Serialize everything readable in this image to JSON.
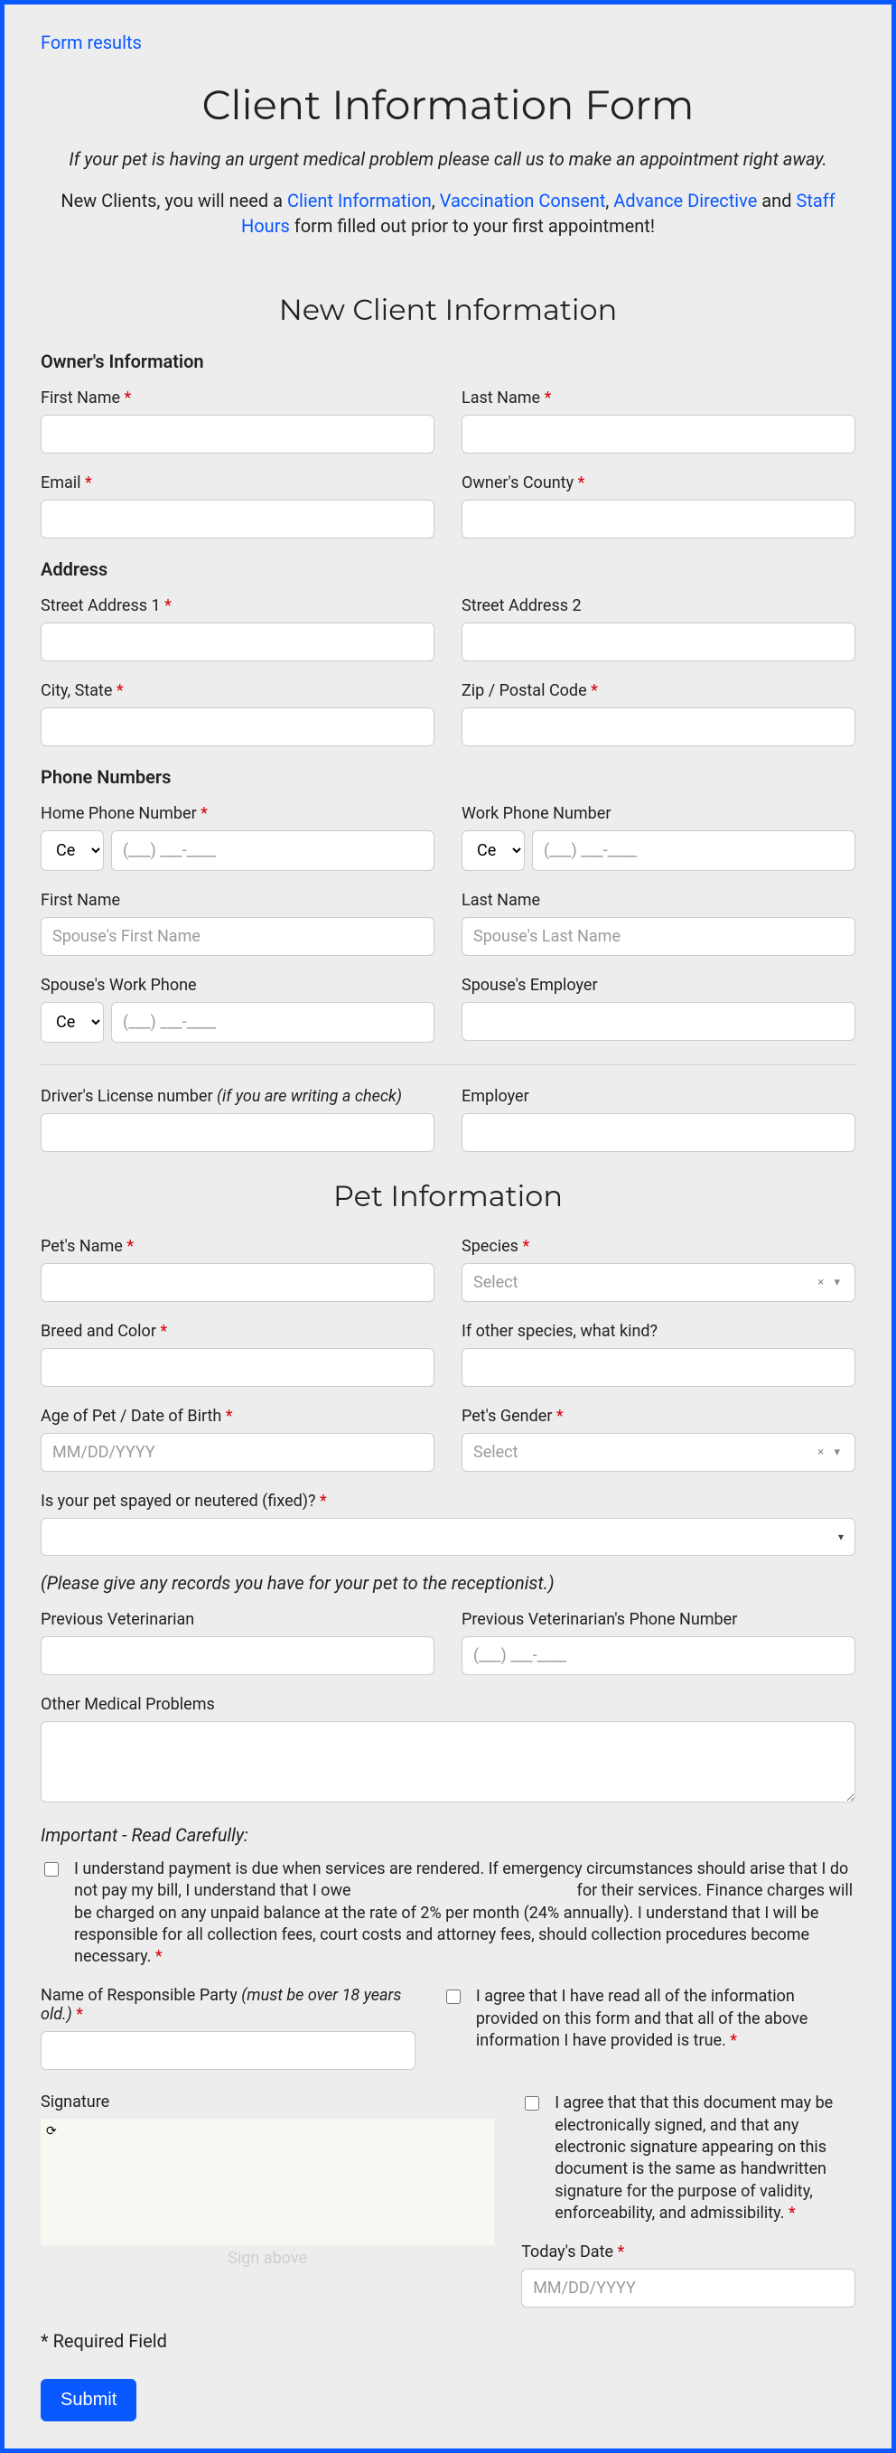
{
  "topLink": "Form results",
  "title": "Client Information Form",
  "subtitle": "If your pet is having an urgent medical problem please call us to make an appointment right away.",
  "introStart": "New Clients, you will need a ",
  "introLinks": {
    "clientInfo": "Client Information",
    "vaccConsent": "Vaccination Consent",
    "advanceDirective": "Advance Directive",
    "staffHours": "Staff Hours"
  },
  "introAnd": " and ",
  "introEnd": " form filled out prior to your first appointment!",
  "newClientHeading": "New Client Information",
  "ownersInfo": "Owner's Information",
  "labels": {
    "firstName": "First Name",
    "lastName": "Last Name",
    "email": "Email",
    "ownersCounty": "Owner's County",
    "address": "Address",
    "street1": "Street Address 1",
    "street2": "Street Address 2",
    "cityState": "City, State",
    "zip": "Zip / Postal Code",
    "phoneNumbers": "Phone Numbers",
    "homePhone": "Home Phone Number",
    "workPhone": "Work Phone Number",
    "spouseFirst": "First Name",
    "spouseLast": "Last Name",
    "spouseWorkPhone": "Spouse's Work Phone",
    "spouseEmployer": "Spouse's Employer",
    "driversLicense": "Driver's License number ",
    "driversLicenseNote": "(if you are writing a check)",
    "employer": "Employer",
    "petInfo": "Pet Information",
    "petName": "Pet's Name",
    "species": "Species",
    "breedColor": "Breed and Color",
    "otherSpecies": "If other species, what kind?",
    "agePet": "Age of Pet / Date of Birth",
    "petGender": "Pet's Gender",
    "spayed": "Is your pet spayed or neutered (fixed)?",
    "recordsNote": "(Please give any records you have for your pet to the receptionist.)",
    "prevVet": "Previous Veterinarian",
    "prevVetPhone": "Previous Veterinarian's Phone Number",
    "otherMedical": "Other Medical Problems",
    "important": "Important - Read Carefully:",
    "consent1a": "I understand payment is due when services are rendered. If emergency circumstances should arise that I do not pay my bill, I understand that I owe ",
    "consent1b": " for their services. Finance charges will be charged on any unpaid balance at the rate of 2% per month (24% annually). I understand that I will be responsible for all collection fees, court costs and attorney fees, should collection procedures become necessary.",
    "responsibleParty": "Name of Responsible Party ",
    "responsiblePartyNote": "(must be over 18 years old.)",
    "consent2": "I agree that I have read all of the information provided on this form and that all of the above information I have provided is true.",
    "signature": "Signature",
    "consent3": "I agree that that this document may be electronically signed, and that any electronic signature appearing on this document is the same as handwritten signature for the purpose of validity, enforceability, and admissibility.",
    "todaysDate": "Today's Date",
    "signAbove": "Sign above",
    "requiredField": "* Required Field",
    "submit": "Submit"
  },
  "placeholders": {
    "spouseFirstPH": "Spouse's First Name",
    "spouseLastPH": "Spouse's Last Name",
    "phoneMask": "(___) ___-____",
    "dateMask": "MM/DD/YYYY",
    "select": "Select"
  },
  "codes": {
    "cell": "Ce"
  }
}
